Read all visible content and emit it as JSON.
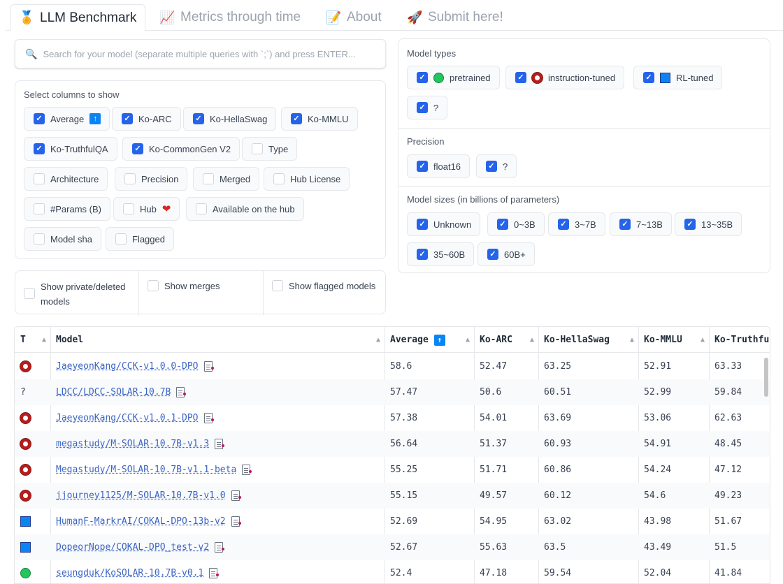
{
  "tabs": [
    {
      "label": "LLM Benchmark",
      "icon": "medal-icon"
    },
    {
      "label": "Metrics through time",
      "icon": "chart-icon"
    },
    {
      "label": "About",
      "icon": "memo-icon"
    },
    {
      "label": "Submit here!",
      "icon": "rocket-icon"
    }
  ],
  "search": {
    "placeholder": "Search for your model (separate multiple queries with `;`) and press ENTER..."
  },
  "columns": {
    "label": "Select columns to show",
    "items": [
      {
        "label": "Average",
        "checked": true
      },
      {
        "label": "Ko-ARC",
        "checked": true
      },
      {
        "label": "Ko-HellaSwag",
        "checked": true
      },
      {
        "label": "Ko-MMLU",
        "checked": true
      },
      {
        "label": "Ko-TruthfulQA",
        "checked": true
      },
      {
        "label": "Ko-CommonGen V2",
        "checked": true
      },
      {
        "label": "Type",
        "checked": false
      },
      {
        "label": "Architecture",
        "checked": false
      },
      {
        "label": "Precision",
        "checked": false
      },
      {
        "label": "Merged",
        "checked": false
      },
      {
        "label": "Hub License",
        "checked": false
      },
      {
        "label": "#Params (B)",
        "checked": false
      },
      {
        "label": "Hub",
        "checked": false
      },
      {
        "label": "Available on the hub",
        "checked": false
      },
      {
        "label": "Model sha",
        "checked": false
      },
      {
        "label": "Flagged",
        "checked": false
      }
    ]
  },
  "toggles": [
    {
      "label": "Show private/deleted models",
      "checked": false
    },
    {
      "label": "Show merges",
      "checked": false
    },
    {
      "label": "Show flagged models",
      "checked": false
    }
  ],
  "model_types": {
    "label": "Model types",
    "items": [
      {
        "label": "pretrained",
        "icon": "green-circle-icon"
      },
      {
        "label": "instruction-tuned",
        "icon": "red-ring-icon"
      },
      {
        "label": "RL-tuned",
        "icon": "blue-square-icon"
      },
      {
        "label": "?",
        "icon": ""
      }
    ]
  },
  "precision": {
    "label": "Precision",
    "items": [
      {
        "label": "float16"
      },
      {
        "label": "?"
      }
    ]
  },
  "model_sizes": {
    "label": "Model sizes (in billions of parameters)",
    "items": [
      {
        "label": "Unknown"
      },
      {
        "label": "0~3B"
      },
      {
        "label": "3~7B"
      },
      {
        "label": "7~13B"
      },
      {
        "label": "13~35B"
      },
      {
        "label": "35~60B"
      },
      {
        "label": "60B+"
      }
    ]
  },
  "table": {
    "headers": [
      "T",
      "Model",
      "Average",
      "Ko-ARC",
      "Ko-HellaSwag",
      "Ko-MMLU",
      "Ko-Truthfu"
    ],
    "rows": [
      {
        "type": "instruction-tuned",
        "type_text": "",
        "model": "JaeyeonKang/CCK-v1.0.0-DPO",
        "average": "58.6",
        "arc": "52.47",
        "hellaswag": "63.25",
        "mmlu": "52.91",
        "truthful": "63.33"
      },
      {
        "type": "unknown",
        "type_text": "?",
        "model": "LDCC/LDCC-SOLAR-10.7B",
        "average": "57.47",
        "arc": "50.6",
        "hellaswag": "60.51",
        "mmlu": "52.99",
        "truthful": "59.84"
      },
      {
        "type": "instruction-tuned",
        "type_text": "",
        "model": "JaeyeonKang/CCK-v1.0.1-DPO",
        "average": "57.38",
        "arc": "54.01",
        "hellaswag": "63.69",
        "mmlu": "53.06",
        "truthful": "62.63"
      },
      {
        "type": "instruction-tuned",
        "type_text": "",
        "model": "megastudy/M-SOLAR-10.7B-v1.3",
        "average": "56.64",
        "arc": "51.37",
        "hellaswag": "60.93",
        "mmlu": "54.91",
        "truthful": "48.45"
      },
      {
        "type": "instruction-tuned",
        "type_text": "",
        "model": "Megastudy/M-SOLAR-10.7B-v1.1-beta",
        "average": "55.25",
        "arc": "51.71",
        "hellaswag": "60.86",
        "mmlu": "54.24",
        "truthful": "47.12"
      },
      {
        "type": "instruction-tuned",
        "type_text": "",
        "model": "jjourney1125/M-SOLAR-10.7B-v1.0",
        "average": "55.15",
        "arc": "49.57",
        "hellaswag": "60.12",
        "mmlu": "54.6",
        "truthful": "49.23"
      },
      {
        "type": "rl-tuned",
        "type_text": "",
        "model": "HumanF-MarkrAI/COKAL-DPO-13b-v2",
        "average": "52.69",
        "arc": "54.95",
        "hellaswag": "63.02",
        "mmlu": "43.98",
        "truthful": "51.67"
      },
      {
        "type": "rl-tuned",
        "type_text": "",
        "model": "DopeorNope/COKAL-DPO_test-v2",
        "average": "52.67",
        "arc": "55.63",
        "hellaswag": "63.5",
        "mmlu": "43.49",
        "truthful": "51.5"
      },
      {
        "type": "pretrained",
        "type_text": "",
        "model": "seungduk/KoSOLAR-10.7B-v0.1",
        "average": "52.4",
        "arc": "47.18",
        "hellaswag": "59.54",
        "mmlu": "52.04",
        "truthful": "41.84"
      }
    ]
  },
  "colors": {
    "accent": "#2563eb",
    "link": "#3b64c4",
    "instruction": "#b91c1c",
    "pretrained": "#22c55e",
    "rl": "#0b84f3"
  }
}
